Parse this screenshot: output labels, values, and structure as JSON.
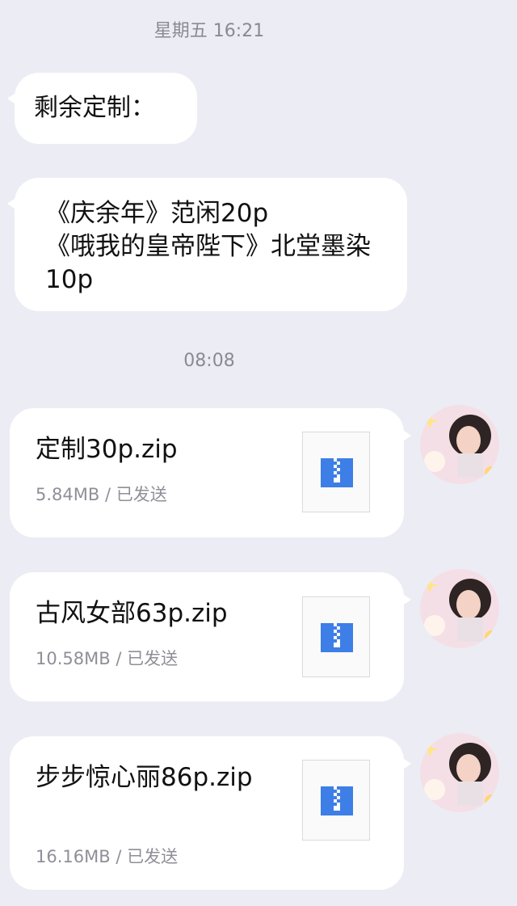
{
  "chat": {
    "timestamp_1": "星期五 16:21",
    "message_1": "剩余定制：",
    "message_2": "《庆余年》范闲20p\n《哦我的皇帝陛下》北堂墨染10p",
    "timestamp_2": "08:08",
    "files": [
      {
        "name": "定制30p.zip",
        "size": "5.84MB",
        "sep": " / ",
        "status": "已发送"
      },
      {
        "name": "古风女部63p.zip",
        "size": "10.58MB",
        "sep": " / ",
        "status": "已发送"
      },
      {
        "name": "步步惊心丽86p.zip",
        "size": "16.16MB",
        "sep": " / ",
        "status": "已发送"
      }
    ]
  },
  "icons": {
    "file_type": "zip-archive-icon",
    "sender": "avatar-photo"
  },
  "colors": {
    "background": "#ececf4",
    "bubble": "#ffffff",
    "zip_icon": "#3d7fe6",
    "meta_text": "#8f8f99",
    "timestamp_text": "#8a8a95"
  }
}
